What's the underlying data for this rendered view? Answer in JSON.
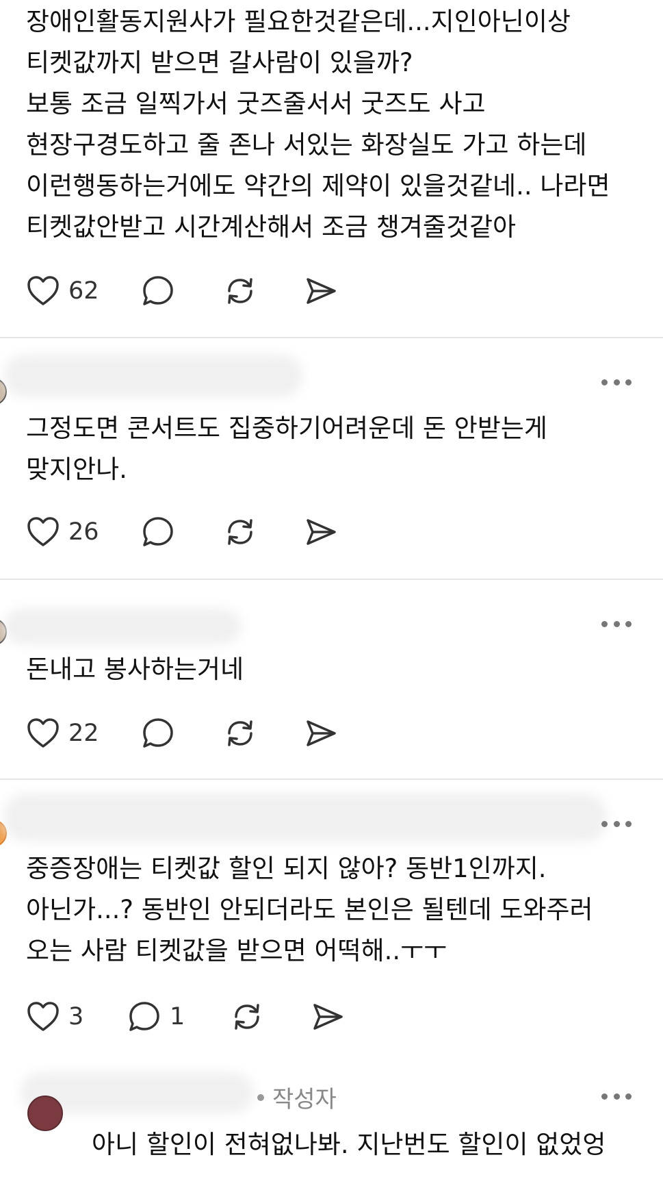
{
  "posts": [
    {
      "text": "장애인활동지원사가 필요한것같은데...지인아닌이상\n티켓값까지 받으면 갈사람이 있을까?\n보통 조금 일찍가서 굿즈줄서서 굿즈도 사고\n현장구경도하고 줄 존나 서있는 화장실도 가고 하는데\n이런행동하는거에도 약간의 제약이 있을것같네.. 나라면\n티켓값안받고 시간계산해서 조금 챙겨줄것같아",
      "likes": "62",
      "replies": ""
    },
    {
      "text": "그정도면 콘서트도 집중하기어려운데 돈 안받는게\n맞지안나.",
      "likes": "26",
      "replies": ""
    },
    {
      "text": "돈내고 봉사하는거네",
      "likes": "22",
      "replies": ""
    },
    {
      "text": "중증장애는 티켓값 할인 되지 않아? 동반1인까지.\n아닌가...? 동반인 안되더라도 본인은 될텐데 도와주러\n오는 사람 티켓값을 받으면 어떡해..ㅜㅜ",
      "likes": "3",
      "replies": "1"
    },
    {
      "text": "아니 할인이 전혀없나봐. 지난번도 할인이 없었엉",
      "author_tag": "작성자"
    }
  ],
  "icons": [
    "heart-icon",
    "comment-icon",
    "repost-icon",
    "share-icon",
    "more-icon"
  ],
  "colors": {
    "text": "#111111",
    "icon": "#333333",
    "muted": "#888888",
    "divider": "#e6e6e6"
  }
}
